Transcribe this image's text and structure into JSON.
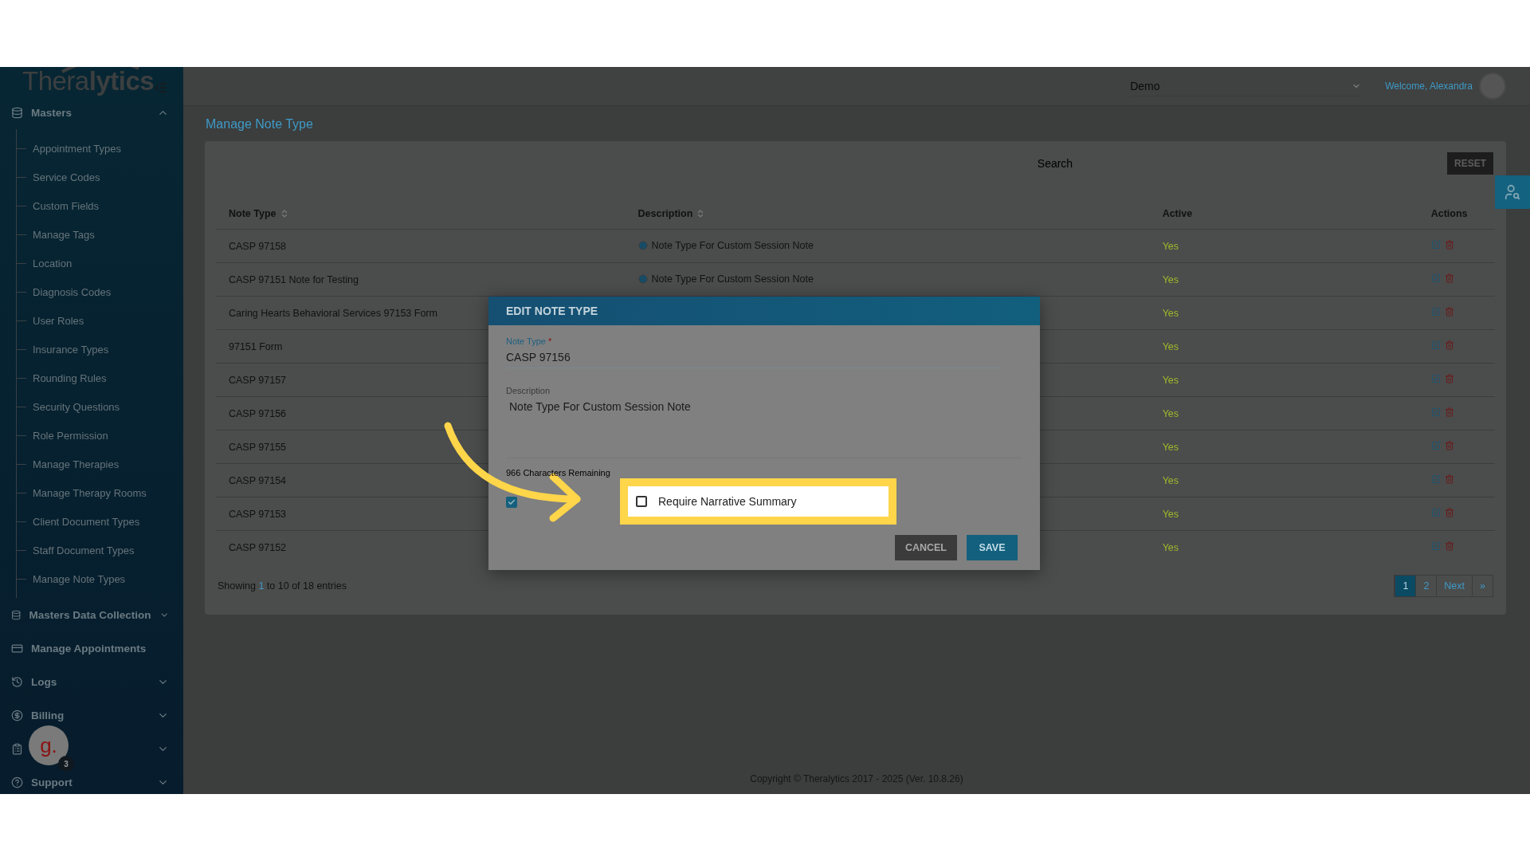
{
  "sidebar": {
    "logo": "Thera**lytics**",
    "groups": [
      {
        "label": "Masters",
        "expanded": true,
        "children": [
          "Appointment Types",
          "Service Codes",
          "Custom Fields",
          "Manage Tags",
          "Location",
          "Diagnosis Codes",
          "User Roles",
          "Insurance Types",
          "Rounding Rules",
          "Security Questions",
          "Role Permission",
          "Manage Therapies",
          "Manage Therapy Rooms",
          "Client Document Types",
          "Staff Document Types",
          "Manage Note Types"
        ]
      },
      {
        "label": "Masters Data Collection",
        "expanded": false
      },
      {
        "label": "Manage Appointments"
      },
      {
        "label": "Logs",
        "expanded": false
      },
      {
        "label": "Billing",
        "expanded": false
      },
      {
        "expanded": false
      },
      {
        "label": "Support",
        "expanded": false
      }
    ]
  },
  "chat_bubble": {
    "letter": "g.",
    "count": "3"
  },
  "topbar": {
    "organization": "Demo",
    "welcome": "Welcome, Alexandra"
  },
  "page_title": "Manage Note Type",
  "search": {
    "placeholder": "Search"
  },
  "reset_button": "RESET",
  "table": {
    "columns": [
      {
        "label": "Note Type",
        "sortable": true
      },
      {
        "label": "Description",
        "sortable": true
      },
      {
        "label": "Active",
        "sortable": false
      },
      {
        "label": "Actions",
        "sortable": false
      }
    ],
    "rows": [
      {
        "note_type": "CASP 97158",
        "description": "Note Type For Custom Session Note",
        "active": "Yes"
      },
      {
        "note_type": "CASP 97151 Note for Testing",
        "description": "Note Type For Custom Session Note",
        "active": "Yes"
      },
      {
        "note_type": "Caring Hearts Behavioral Services 97153 Form",
        "active": "Yes"
      },
      {
        "note_type": "97151 Form",
        "active": "Yes"
      },
      {
        "note_type": "CASP 97157",
        "active": "Yes"
      },
      {
        "note_type": "CASP 97156",
        "active": "Yes"
      },
      {
        "note_type": "CASP 97155",
        "active": "Yes"
      },
      {
        "note_type": "CASP 97154",
        "active": "Yes"
      },
      {
        "note_type": "CASP 97153",
        "active": "Yes"
      },
      {
        "note_type": "CASP 97152",
        "active": "Yes"
      }
    ]
  },
  "entries_info": "Showing **1** to 10 of 18 entries",
  "pagination": [
    {
      "label": "1",
      "selected": true
    },
    {
      "label": "2",
      "selected": false
    },
    {
      "label": "Next",
      "selected": false
    },
    {
      "label": "»",
      "selected": false
    }
  ],
  "footer": "Copyright © Theralytics 2017 - 2025 (Ver. 10.8.26)",
  "dialog": {
    "title": "EDIT NOTE TYPE",
    "note_type_label": "Note Type",
    "required_mark": "*",
    "note_type_value": "CASP 97156",
    "description_label": "Description",
    "description_value": "Note Type For Custom Session Note",
    "characters_remaining": "966 Characters Remaining",
    "active_checkbox": {
      "checked": true
    },
    "narrative_checkbox": {
      "label": "Require Narrative Summary",
      "checked": false
    },
    "buttons": [
      "CANCEL",
      "SAVE"
    ]
  }
}
